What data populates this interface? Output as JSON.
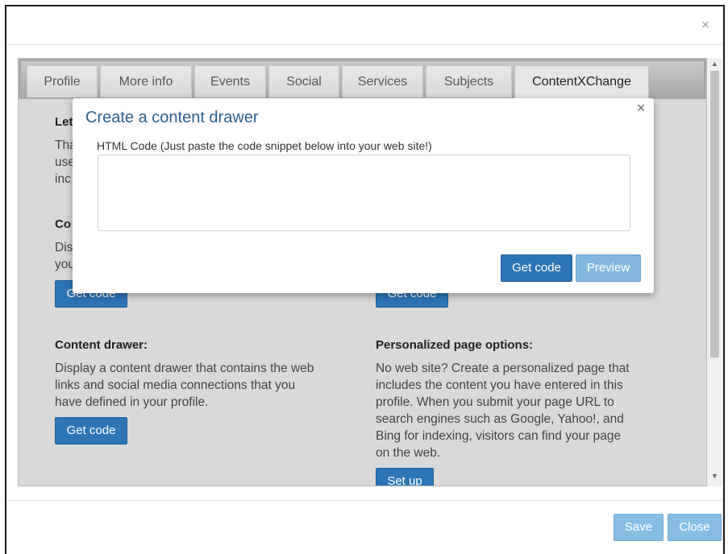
{
  "dialog": {
    "close_symbol": "×"
  },
  "tabs": [
    {
      "label": "Profile"
    },
    {
      "label": "More info"
    },
    {
      "label": "Events"
    },
    {
      "label": "Social"
    },
    {
      "label": "Services"
    },
    {
      "label": "Subjects"
    },
    {
      "label": "ContentXChange",
      "active": true
    }
  ],
  "sections": {
    "top_left": {
      "heading_partial": "Let",
      "text_partial": [
        "Tha",
        "use",
        "inc"
      ]
    },
    "mid_left": {
      "heading_partial": "Co",
      "text_partial": [
        "Dis",
        "you"
      ],
      "button_partial": "Get code"
    },
    "mid_right": {
      "button_partial": "Get code"
    },
    "content_drawer": {
      "heading": "Content drawer:",
      "text_lines": [
        "Display a content drawer that contains the web",
        "links and social media connections that you",
        "have defined in your profile."
      ],
      "button": "Get code"
    },
    "personalized": {
      "heading": "Personalized page options:",
      "text_lines": [
        "No web site? Create a personalized page that",
        "includes the content you have entered in this",
        "profile. When you submit your page URL to",
        "search engines such as Google, Yahoo!, and",
        "Bing for indexing, visitors can find your page",
        "on the web."
      ],
      "button": "Set up"
    }
  },
  "modal": {
    "title": "Create a content drawer",
    "close_symbol": "×",
    "label": "HTML Code (Just paste the code snippet below into your web site!)",
    "textarea_value": "",
    "get_code": "Get code",
    "preview": "Preview"
  },
  "footer": {
    "save": "Save",
    "close": "Close"
  },
  "scrollbar": {
    "up": "▲",
    "down": "▼"
  },
  "colors": {
    "primary": "#2e75b6",
    "light_primary": "#88bde3",
    "modal_title": "#2a5d8c"
  }
}
